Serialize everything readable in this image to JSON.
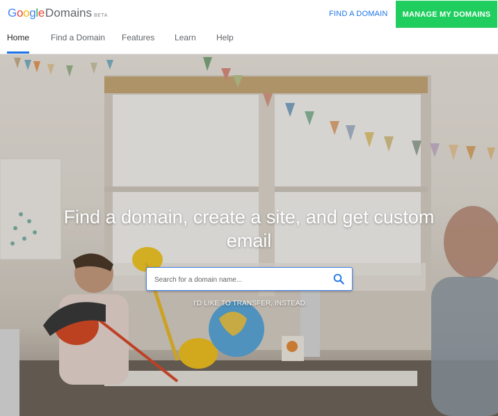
{
  "header": {
    "logo_letters": [
      {
        "char": "G",
        "color": "#4285F4"
      },
      {
        "char": "o",
        "color": "#EA4335"
      },
      {
        "char": "o",
        "color": "#FBBC05"
      },
      {
        "char": "g",
        "color": "#4285F4"
      },
      {
        "char": "l",
        "color": "#34A853"
      },
      {
        "char": "e",
        "color": "#EA4335"
      }
    ],
    "logo_domains": "Domains",
    "logo_beta": "BETA",
    "find_domain_label": "FIND A DOMAIN",
    "manage_label": "MANAGE MY DOMAINS"
  },
  "nav": {
    "items": [
      {
        "label": "Home",
        "active": true
      },
      {
        "label": "Find a Domain",
        "active": false
      },
      {
        "label": "Features",
        "active": false
      },
      {
        "label": "Learn",
        "active": false
      },
      {
        "label": "Help",
        "active": false
      }
    ]
  },
  "hero": {
    "title": "Find a domain, create a site, and get custom email",
    "search_placeholder": "Search for a domain name...",
    "search_value": "",
    "transfer_label": "I'D LIKE TO TRANSFER, INSTEAD."
  },
  "colors": {
    "accent_blue": "#1a73e8",
    "manage_green": "#1fce5e"
  },
  "icons": {
    "search": "search-icon"
  }
}
